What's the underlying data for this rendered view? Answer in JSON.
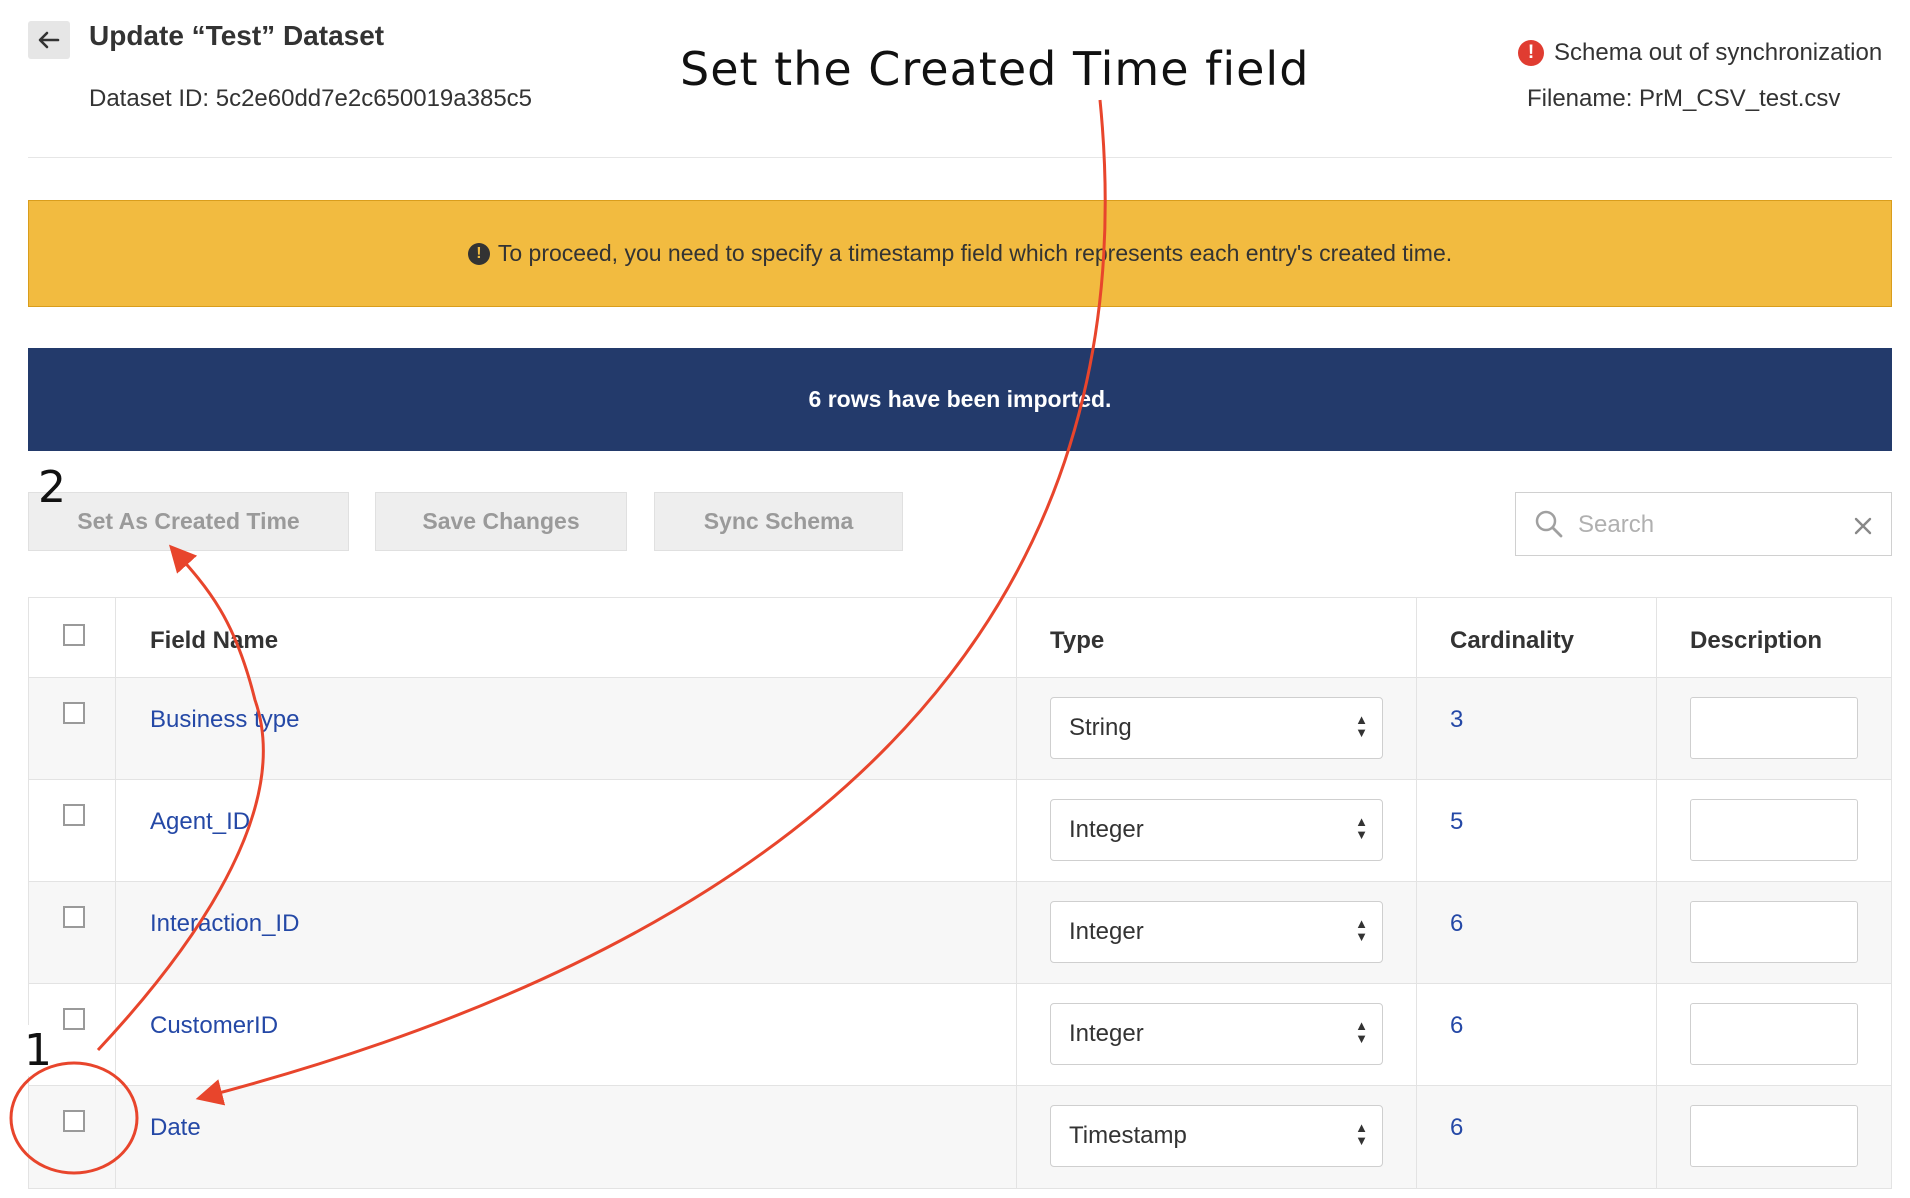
{
  "header": {
    "title": "Update “Test” Dataset",
    "dataset_id": "Dataset ID: 5c2e60dd7e2c650019a385c5",
    "sync_status": "Schema out of synchronization",
    "sync_icon": "!",
    "filename": "Filename: PrM_CSV_test.csv"
  },
  "warning_banner": {
    "text": "To proceed, you need to specify a timestamp field which represents each entry's created time.",
    "icon": "!"
  },
  "info_banner": {
    "text": "6 rows have been imported."
  },
  "toolbar": {
    "set_created_time": "Set As Created Time",
    "save_changes": "Save Changes",
    "sync_schema": "Sync Schema"
  },
  "search": {
    "placeholder": "Search",
    "value": ""
  },
  "table": {
    "headers": {
      "field_name": "Field Name",
      "type": "Type",
      "cardinality": "Cardinality",
      "description": "Description"
    },
    "rows": [
      {
        "field_name": "Business type",
        "type": "String",
        "cardinality": "3",
        "checked": false
      },
      {
        "field_name": "Agent_ID",
        "type": "Integer",
        "cardinality": "5",
        "checked": false
      },
      {
        "field_name": "Interaction_ID",
        "type": "Integer",
        "cardinality": "6",
        "checked": false
      },
      {
        "field_name": "CustomerID",
        "type": "Integer",
        "cardinality": "6",
        "checked": false
      },
      {
        "field_name": "Date",
        "type": "Timestamp",
        "cardinality": "6",
        "checked": false
      }
    ]
  },
  "annotations": {
    "title": "Set the Created Time field",
    "step1": "1",
    "step2": "2",
    "color": "#e8452c"
  },
  "colors": {
    "warning": "#f2bb40",
    "info": "#233a6b",
    "link": "#2448a6",
    "alert": "#e03c31"
  }
}
